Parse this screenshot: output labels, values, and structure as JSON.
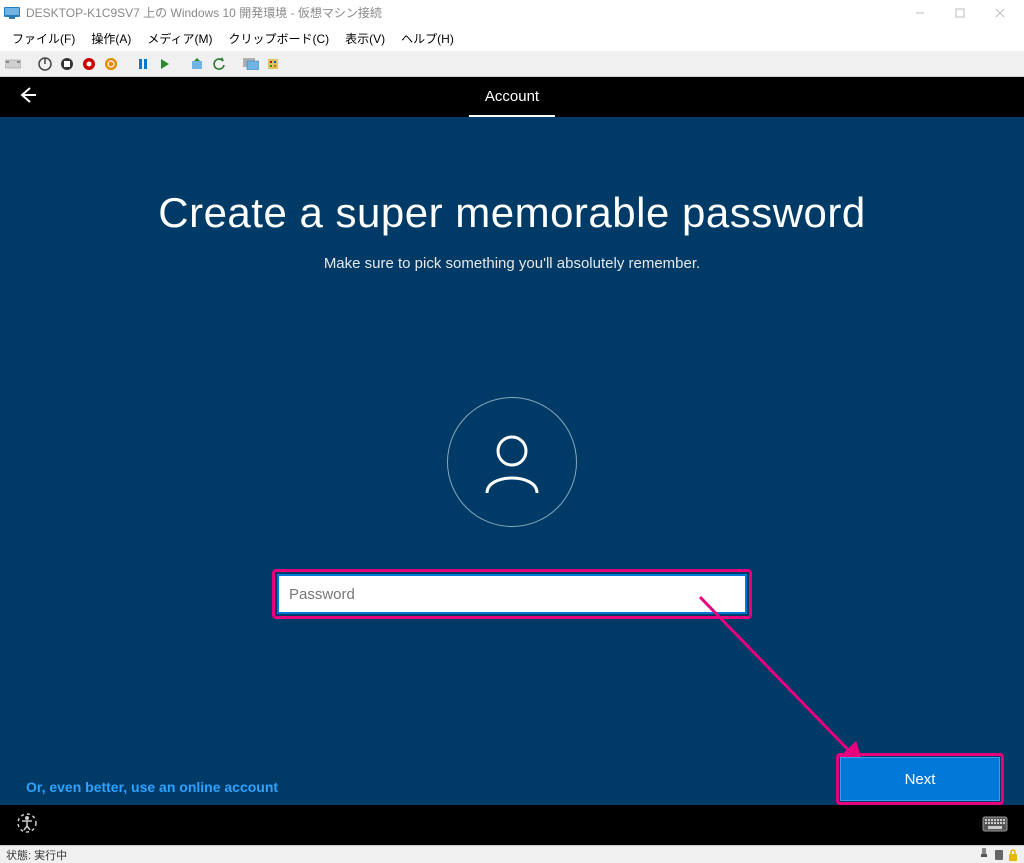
{
  "host": {
    "title": "DESKTOP-K1C9SV7 上の Windows 10 開発環境  - 仮想マシン接続",
    "menu": {
      "file": "ファイル(F)",
      "action": "操作(A)",
      "media": "メディア(M)",
      "clipboard": "クリップボード(C)",
      "view": "表示(V)",
      "help": "ヘルプ(H)"
    },
    "status": "状態: 実行中"
  },
  "oobe": {
    "tab_active": "Account",
    "heading": "Create a super memorable password",
    "subheading": "Make sure to pick something you'll absolutely remember.",
    "password_placeholder": "Password",
    "password_value": "",
    "online_link": "Or, even better, use an online account",
    "next_button": "Next"
  },
  "annotation": {
    "highlight_color": "#e6007e"
  }
}
